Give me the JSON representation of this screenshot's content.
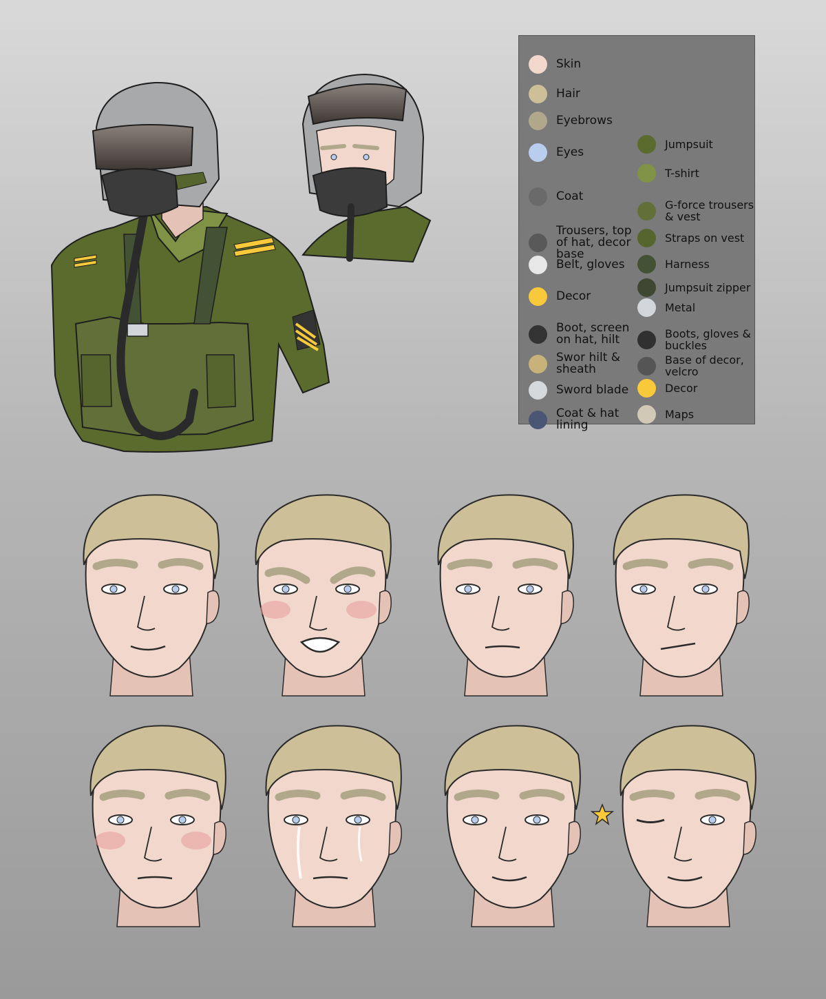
{
  "palette": {
    "left_column": [
      {
        "label": "Skin",
        "color": "#f2d8cc"
      },
      {
        "label": "Hair",
        "color": "#cdbf98"
      },
      {
        "label": "Eyebrows",
        "color": "#b1a78a"
      },
      {
        "label": "Eyes",
        "color": "#b9cdef"
      },
      {
        "label": "Coat",
        "color": "#6a6a6a"
      },
      {
        "label": "Trousers, top of hat, decor base",
        "color": "#595959"
      },
      {
        "label": "Belt, gloves",
        "color": "#e7e7e7"
      },
      {
        "label": "Decor",
        "color": "#f7c93b"
      },
      {
        "label": "Boot, screen on hat, hilt",
        "color": "#333333"
      },
      {
        "label": "Swor hilt & sheath",
        "color": "#c9b27a"
      },
      {
        "label": "Sword blade",
        "color": "#d6d9dc"
      },
      {
        "label": "Coat & hat lining",
        "color": "#4a5673"
      }
    ],
    "right_column": [
      {
        "label": "Jumpsuit",
        "color": "#5a6b2d"
      },
      {
        "label": "T-shirt",
        "color": "#7f9245"
      },
      {
        "label": "G-force trousers & vest",
        "color": "#626f39"
      },
      {
        "label": "Straps on vest",
        "color": "#56652d"
      },
      {
        "label": "Harness",
        "color": "#435234"
      },
      {
        "label": "Jumpsuit zipper",
        "color": "#3f4733"
      },
      {
        "label": "Metal",
        "color": "#d2d5d9"
      },
      {
        "label": "Boots, gloves & buckles",
        "color": "#303030"
      },
      {
        "label": "Base of decor, velcro",
        "color": "#555555"
      },
      {
        "label": "Decor",
        "color": "#f7c93b"
      },
      {
        "label": "Maps",
        "color": "#d1c9b6"
      }
    ]
  },
  "colors": {
    "skin": "#f2d8cc",
    "skin_shadow": "#e4c2b6",
    "hair": "#cdbf98",
    "hair_dark": "#a89a74",
    "eyebrows": "#b1a78a",
    "eyes": "#b9cdef",
    "jumpsuit": "#5a6b2d",
    "vest": "#626f39",
    "helmet": "#a7a9aa",
    "visor": "#4f4844",
    "mask": "#3b3b3b",
    "decor": "#f7c93b",
    "line": "#2a2a2a",
    "blush": "#e79b9b",
    "tear": "#ffffff"
  },
  "expressions": [
    {
      "name": "smile"
    },
    {
      "name": "angry"
    },
    {
      "name": "neutral"
    },
    {
      "name": "skeptical"
    },
    {
      "name": "blushing"
    },
    {
      "name": "crying"
    },
    {
      "name": "smug"
    },
    {
      "name": "wink"
    }
  ],
  "icons": {
    "wink_star": "star-icon",
    "sergeant_badge": "chevron-rank-icon",
    "shoulder_rank": "shoulder-stripe-icon"
  }
}
